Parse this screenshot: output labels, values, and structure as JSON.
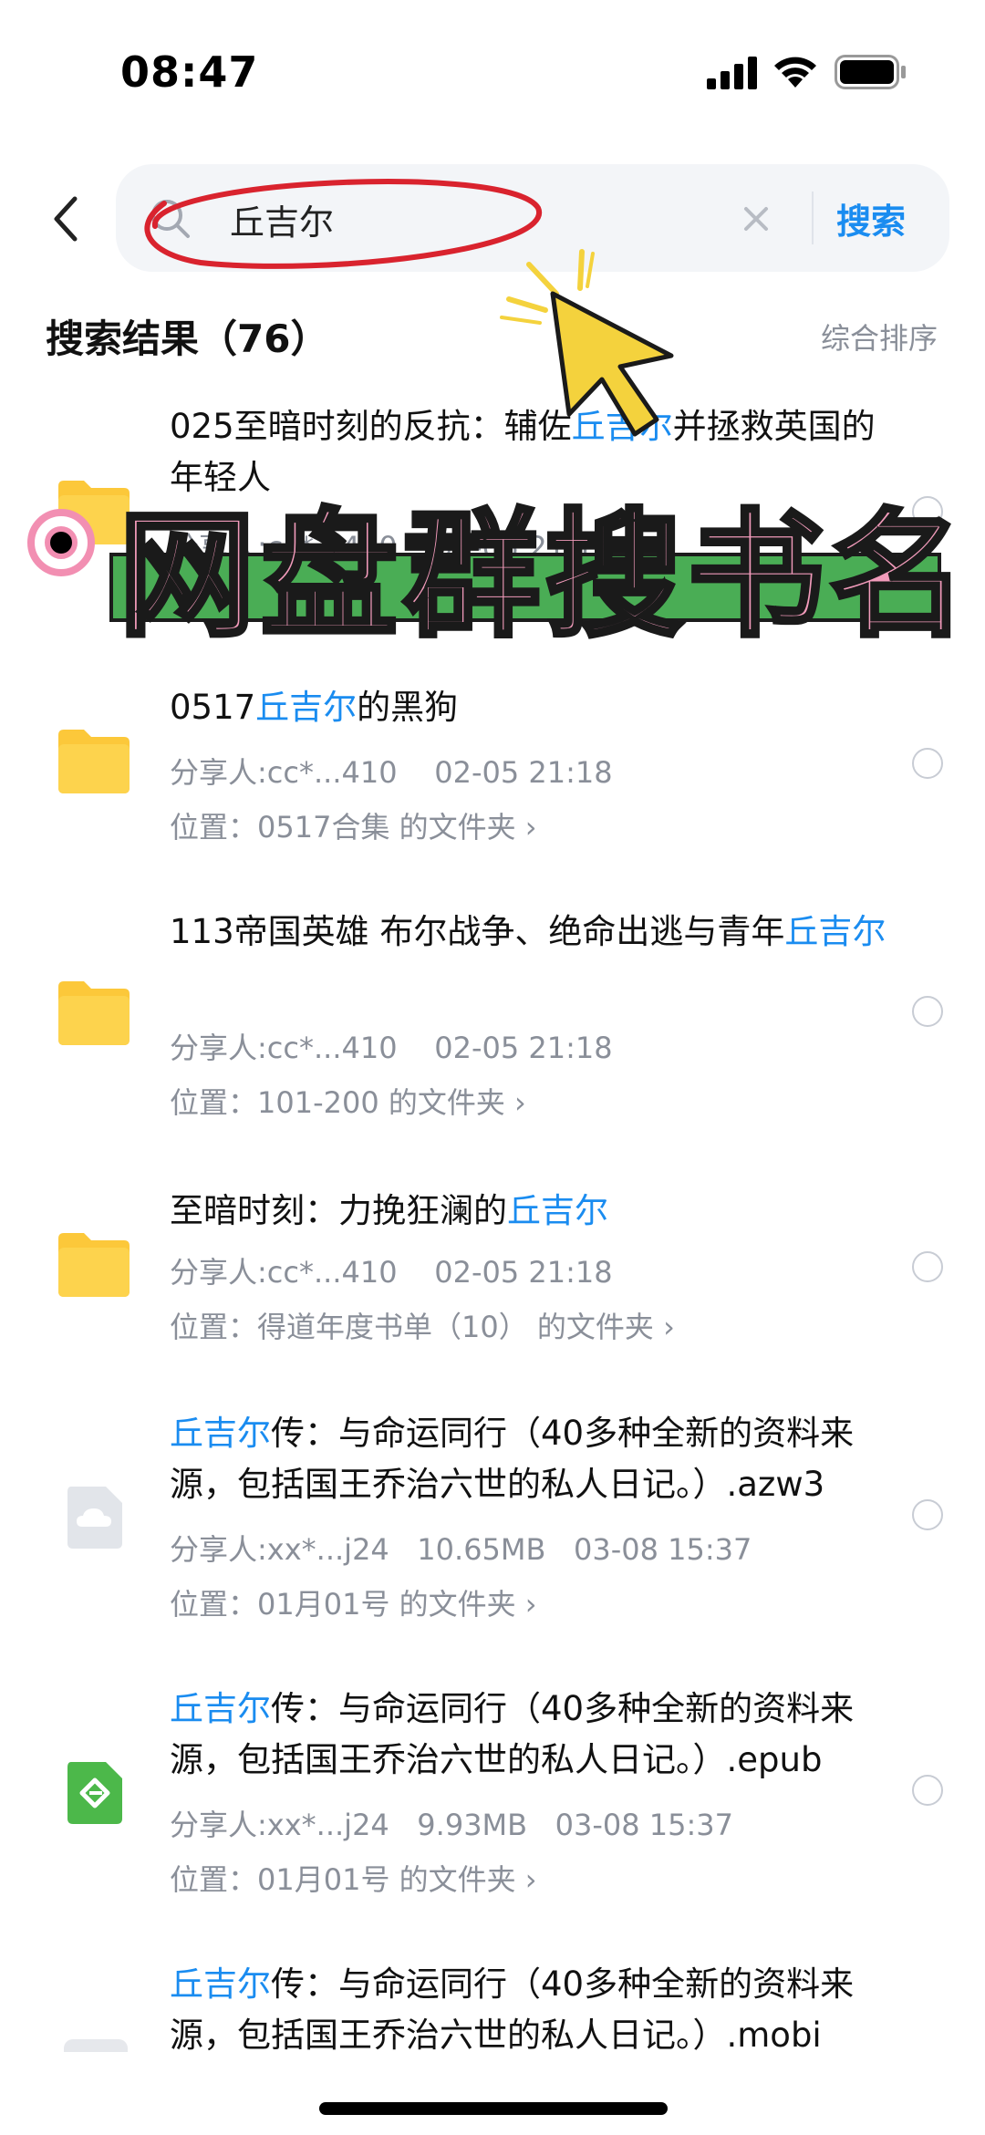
{
  "status_bar": {
    "time": "08:47"
  },
  "search": {
    "query": "丘吉尔",
    "button_label": "搜索"
  },
  "results_header": {
    "title": "搜索结果（76）",
    "sort_label": "综合排序"
  },
  "overlay": {
    "banner_text": "网盘群搜书名"
  },
  "results": [
    {
      "type": "folder",
      "title_parts": [
        "025至暗时刻的反抗：辅佐",
        "丘吉尔",
        "并拯救英国的年轻人"
      ],
      "meta": "分享人:cc*...410    02-05 21:18"
    },
    {
      "type": "folder",
      "title_parts": [
        "0517",
        "丘吉尔",
        "的黑狗"
      ],
      "meta": "分享人:cc*...410    02-05 21:18",
      "location": "位置：0517合集 的文件夹 ›"
    },
    {
      "type": "folder",
      "title_parts": [
        "113帝国英雄  布尔战争、绝命出逃与青年",
        "丘吉尔",
        ""
      ],
      "meta": "分享人:cc*...410    02-05 21:18",
      "location": "位置：101-200 的文件夹 ›"
    },
    {
      "type": "folder",
      "title_parts": [
        "至暗时刻：力挽狂澜的",
        "丘吉尔",
        ""
      ],
      "meta": "分享人:cc*...410    02-05 21:18",
      "location": "位置：得道年度书单（10） 的文件夹 ›"
    },
    {
      "type": "cloud-file",
      "title_parts": [
        "",
        "丘吉尔",
        "传：与命运同行（40多种全新的资料来源，包括国王乔治六世的私人日记。）.azw3"
      ],
      "meta": "分享人:xx*...j24   10.65MB   03-08 15:37",
      "location": "位置：01月01号 的文件夹 ›"
    },
    {
      "type": "epub-file",
      "title_parts": [
        "",
        "丘吉尔",
        "传：与命运同行（40多种全新的资料来源，包括国王乔治六世的私人日记。）.epub"
      ],
      "meta": "分享人:xx*...j24   9.93MB   03-08 15:37",
      "location": "位置：01月01号 的文件夹 ›"
    },
    {
      "type": "file",
      "title_parts": [
        "",
        "丘吉尔",
        "传：与命运同行（40多种全新的资料来源，包括国王乔治六世的私人日记。）.mobi"
      ]
    }
  ],
  "colors": {
    "accent": "#1a8cf0",
    "secondary_text": "#8a8f99",
    "folder_yellow": "#fcc83a",
    "banner_green": "#4aad55",
    "banner_pink": "#f29bbb",
    "annotation_red": "#d9232e",
    "cursor_yellow": "#f4d23d"
  }
}
